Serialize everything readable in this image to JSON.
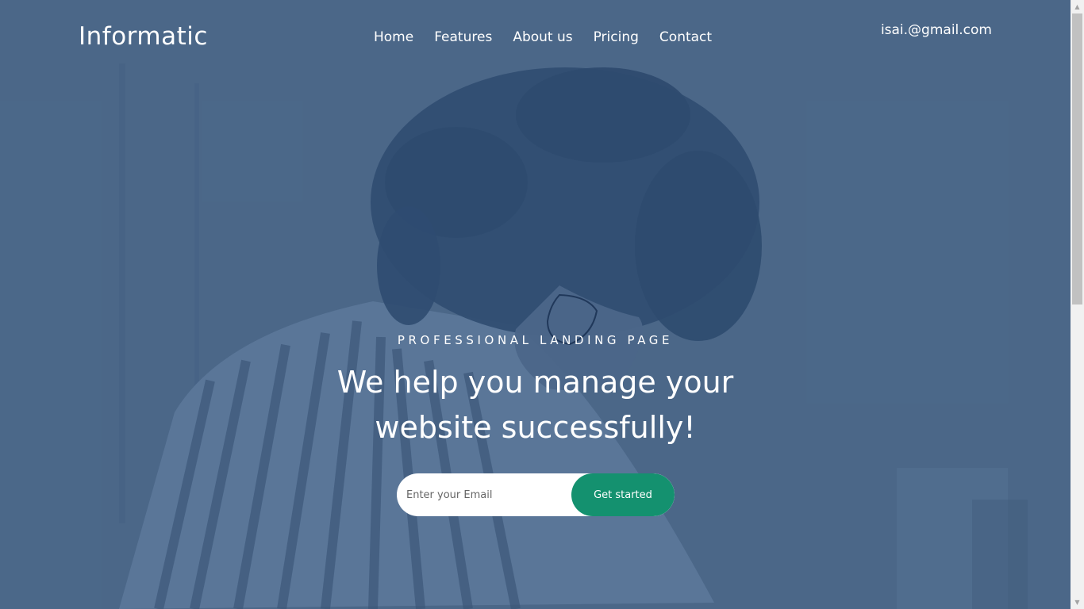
{
  "brand": {
    "name": "Informatic"
  },
  "nav": {
    "items": [
      "Home",
      "Features",
      "About us",
      "Pricing",
      "Contact"
    ]
  },
  "header": {
    "email": "isai.@gmail.com"
  },
  "hero": {
    "eyebrow": "PROFESSIONAL LANDING PAGE",
    "headline": "We help you manage your website successfully!",
    "email_placeholder": "Enter your Email",
    "cta_label": "Get started"
  },
  "colors": {
    "overlay": "#4f6d8f",
    "cta": "#14916f",
    "text": "#ffffff"
  },
  "icons": {
    "scroll_up": "scroll-up-arrow",
    "scroll_down": "scroll-down-arrow"
  }
}
